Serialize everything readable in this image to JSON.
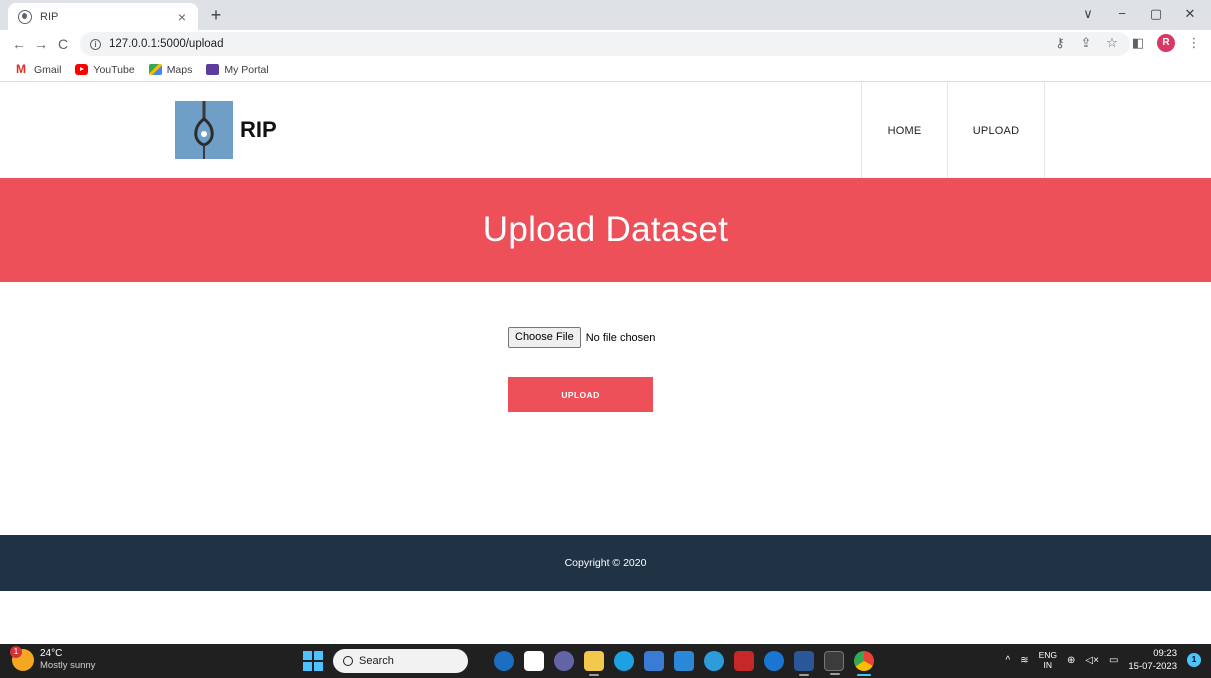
{
  "browser": {
    "tab_title": "RIP",
    "tab_close": "×",
    "new_tab": "+",
    "url": "127.0.0.1:5000/upload",
    "back": "←",
    "forward": "→",
    "reload": "C",
    "window_controls": [
      "∨",
      "−",
      "▢",
      "✕"
    ],
    "toolbar_icons": [
      "key-icon",
      "share-icon",
      "star-icon",
      "sidepanel-icon",
      "profile-icon",
      "menu-icon"
    ],
    "profile_initial": "R",
    "bookmarks": [
      {
        "label": "Gmail",
        "icon": "gmail-icon"
      },
      {
        "label": "YouTube",
        "icon": "youtube-icon"
      },
      {
        "label": "Maps",
        "icon": "maps-icon"
      },
      {
        "label": "My Portal",
        "icon": "portal-icon"
      }
    ]
  },
  "site": {
    "brand": "RIP",
    "nav": {
      "home": "HOME",
      "upload": "UPLOAD"
    },
    "hero_title": "Upload Dataset",
    "file_input": {
      "button_label": "Choose File",
      "status": "No file chosen"
    },
    "upload_button": "UPLOAD",
    "footer": "Copyright © 2020",
    "colors": {
      "accent": "#ed5058",
      "footer": "#1f3344"
    }
  },
  "taskbar": {
    "weather": {
      "badge": "1",
      "temp": "24°C",
      "desc": "Mostly sunny"
    },
    "search_label": "Search",
    "lang_top": "ENG",
    "lang_bottom": "IN",
    "time": "09:23",
    "date": "15-07-2023",
    "notif_count": "1"
  }
}
